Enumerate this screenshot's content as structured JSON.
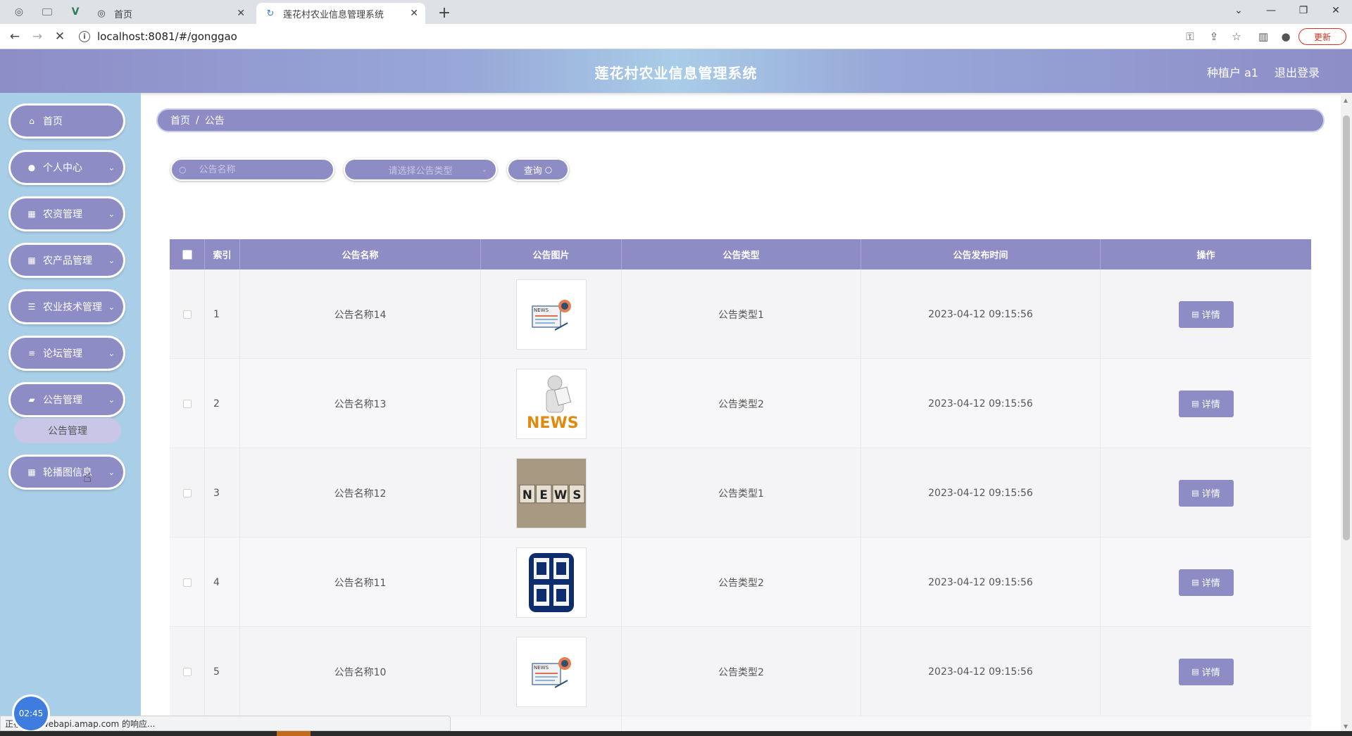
{
  "browser": {
    "tabs": [
      {
        "label": "首页",
        "icon": "globe-icon"
      },
      {
        "label": "莲花村农业信息管理系统",
        "icon": "app-logo-icon"
      }
    ],
    "url": "localhost:8081/#/gonggao",
    "update_label": "更新"
  },
  "header": {
    "title": "莲花村农业信息管理系统",
    "user": "种植户 a1",
    "logout": "退出登录"
  },
  "sidebar": {
    "items": [
      {
        "label": "首页",
        "icon": "home-icon",
        "has_chevron": false
      },
      {
        "label": "个人中心",
        "icon": "user-icon",
        "has_chevron": true
      },
      {
        "label": "农资管理",
        "icon": "grid-icon",
        "has_chevron": true
      },
      {
        "label": "农产品管理",
        "icon": "grid-icon",
        "has_chevron": true
      },
      {
        "label": "农业技术管理",
        "icon": "sliders-icon",
        "has_chevron": true
      },
      {
        "label": "论坛管理",
        "icon": "list-icon",
        "has_chevron": true
      },
      {
        "label": "公告管理",
        "icon": "notice-icon",
        "has_chevron": true
      },
      {
        "label": "轮播图信息",
        "icon": "grid-icon",
        "has_chevron": true
      }
    ],
    "submenu": {
      "label": "公告管理"
    }
  },
  "breadcrumb": {
    "home": "首页",
    "sep": "/",
    "current": "公告"
  },
  "search": {
    "name_placeholder": "公告名称",
    "type_placeholder": "请选择公告类型",
    "query_label": "查询"
  },
  "table": {
    "headers": {
      "index": "索引",
      "name": "公告名称",
      "image": "公告图片",
      "type": "公告类型",
      "time": "公告发布时间",
      "action": "操作"
    },
    "rows": [
      {
        "index": "1",
        "name": "公告名称14",
        "image": "news-paper-icon",
        "type": "公告类型1",
        "time": "2023-04-12 09:15:56",
        "action": "详情"
      },
      {
        "index": "2",
        "name": "公告名称13",
        "image": "news-figure-icon",
        "type": "公告类型2",
        "time": "2023-04-12 09:15:56",
        "action": "详情"
      },
      {
        "index": "3",
        "name": "公告名称12",
        "image": "news-blocks-icon",
        "type": "公告类型1",
        "time": "2023-04-12 09:15:56",
        "action": "详情"
      },
      {
        "index": "4",
        "name": "公告名称11",
        "image": "cctv-news-icon",
        "type": "公告类型2",
        "time": "2023-04-12 09:15:56",
        "action": "详情"
      },
      {
        "index": "5",
        "name": "公告名称10",
        "image": "news-paper-icon",
        "type": "公告类型2",
        "time": "2023-04-12 09:15:56",
        "action": "详情"
      }
    ]
  },
  "status": {
    "text": "正在等待 webapi.amap.com 的响应...",
    "timer": "02:45"
  },
  "colors": {
    "accent": "#8e8cc5",
    "sidebar_bg": "#a9cfe8",
    "header_gradient_mid": "#a9cde8"
  }
}
